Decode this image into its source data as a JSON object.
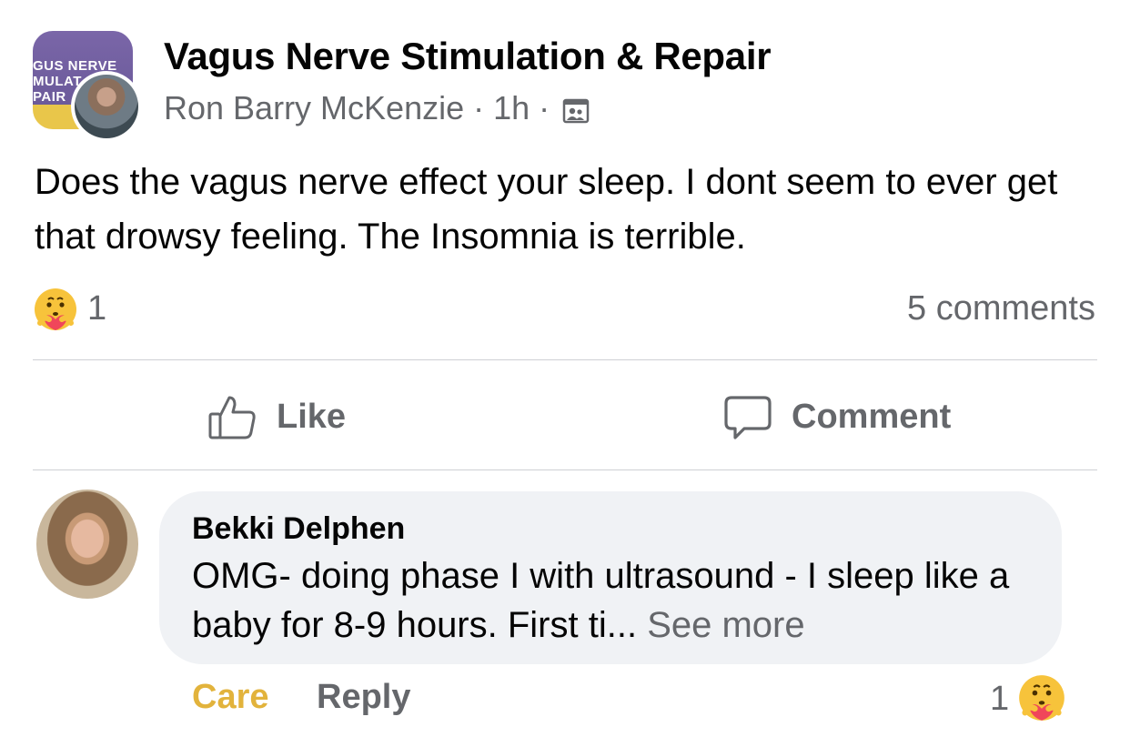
{
  "post": {
    "group_name": "Vagus Nerve Stimulation & Repair",
    "group_avatar_text": "GUS NERVE\nMULAT\nPAIR",
    "author": "Ron Barry McKenzie",
    "separator": "·",
    "time": "1h",
    "audience_icon": "group-members-icon",
    "text": "Does the vagus nerve effect your sleep. I dont seem to ever get that drowsy feeling. The Insomnia is terrible.",
    "reaction_icon": "care-emoji-icon",
    "reaction_count": "1",
    "comments_label": "5 comments"
  },
  "actions": {
    "like_label": "Like",
    "comment_label": "Comment"
  },
  "comment": {
    "author": "Bekki Delphen",
    "text": "OMG- doing phase I with ultrasound - I sleep like a baby for 8-9 hours. First ti...",
    "see_more": "See more",
    "care_label": "Care",
    "reply_label": "Reply",
    "reaction_count": "1",
    "reaction_icon": "care-emoji-icon"
  },
  "colors": {
    "secondary_text": "#65676b",
    "care_yellow": "#e2b33c",
    "bubble_bg": "#f0f2f5",
    "divider": "#ced0d4"
  }
}
